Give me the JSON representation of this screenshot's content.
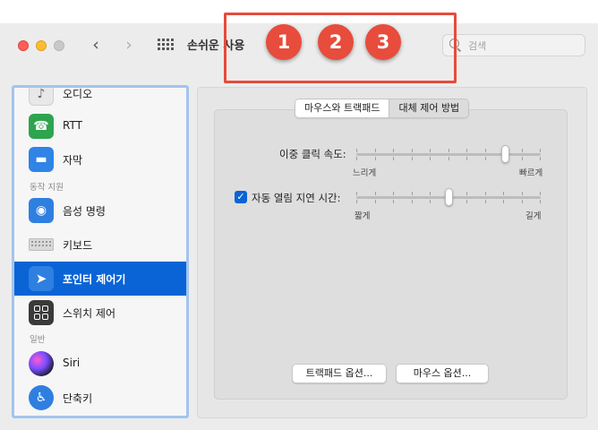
{
  "window": {
    "title": "손쉬운 사용",
    "search_placeholder": "검색"
  },
  "annotations": {
    "color": "#e74c3c",
    "badges": [
      "1",
      "2",
      "3"
    ]
  },
  "sidebar": {
    "sections": {
      "motor": "동작 지원",
      "general": "일반"
    },
    "items": [
      {
        "label": "오디오",
        "icon": "speaker-icon"
      },
      {
        "label": "RTT",
        "icon": "rtt-phone-icon"
      },
      {
        "label": "자막",
        "icon": "captions-icon"
      },
      {
        "label": "음성 명령",
        "icon": "voice-control-icon"
      },
      {
        "label": "키보드",
        "icon": "keyboard-icon"
      },
      {
        "label": "포인터 제어기",
        "icon": "pointer-icon",
        "selected": true
      },
      {
        "label": "스위치 제어",
        "icon": "switch-control-icon"
      },
      {
        "label": "Siri",
        "icon": "siri-icon"
      },
      {
        "label": "단축키",
        "icon": "accessibility-shortcut-icon"
      }
    ]
  },
  "main": {
    "tabs": [
      {
        "label": "마우스와 트랙패드",
        "active": true
      },
      {
        "label": "대체 제어 방법",
        "active": false
      }
    ],
    "double_click": {
      "label": "이중 클릭 속도:",
      "min_label": "느리게",
      "max_label": "빠르게",
      "value_fraction": 0.82
    },
    "spring_loading": {
      "checked": true,
      "label": "자동 열림 지연 시간:",
      "min_label": "짧게",
      "max_label": "길게",
      "value_fraction": 0.5
    },
    "buttons": {
      "trackpad_options": "트랙패드 옵션...",
      "mouse_options": "마우스 옵션..."
    }
  },
  "colors": {
    "accent": "#0a64d6",
    "selection": "#0a64d6",
    "sidebar_border": "#a3c4ee"
  }
}
